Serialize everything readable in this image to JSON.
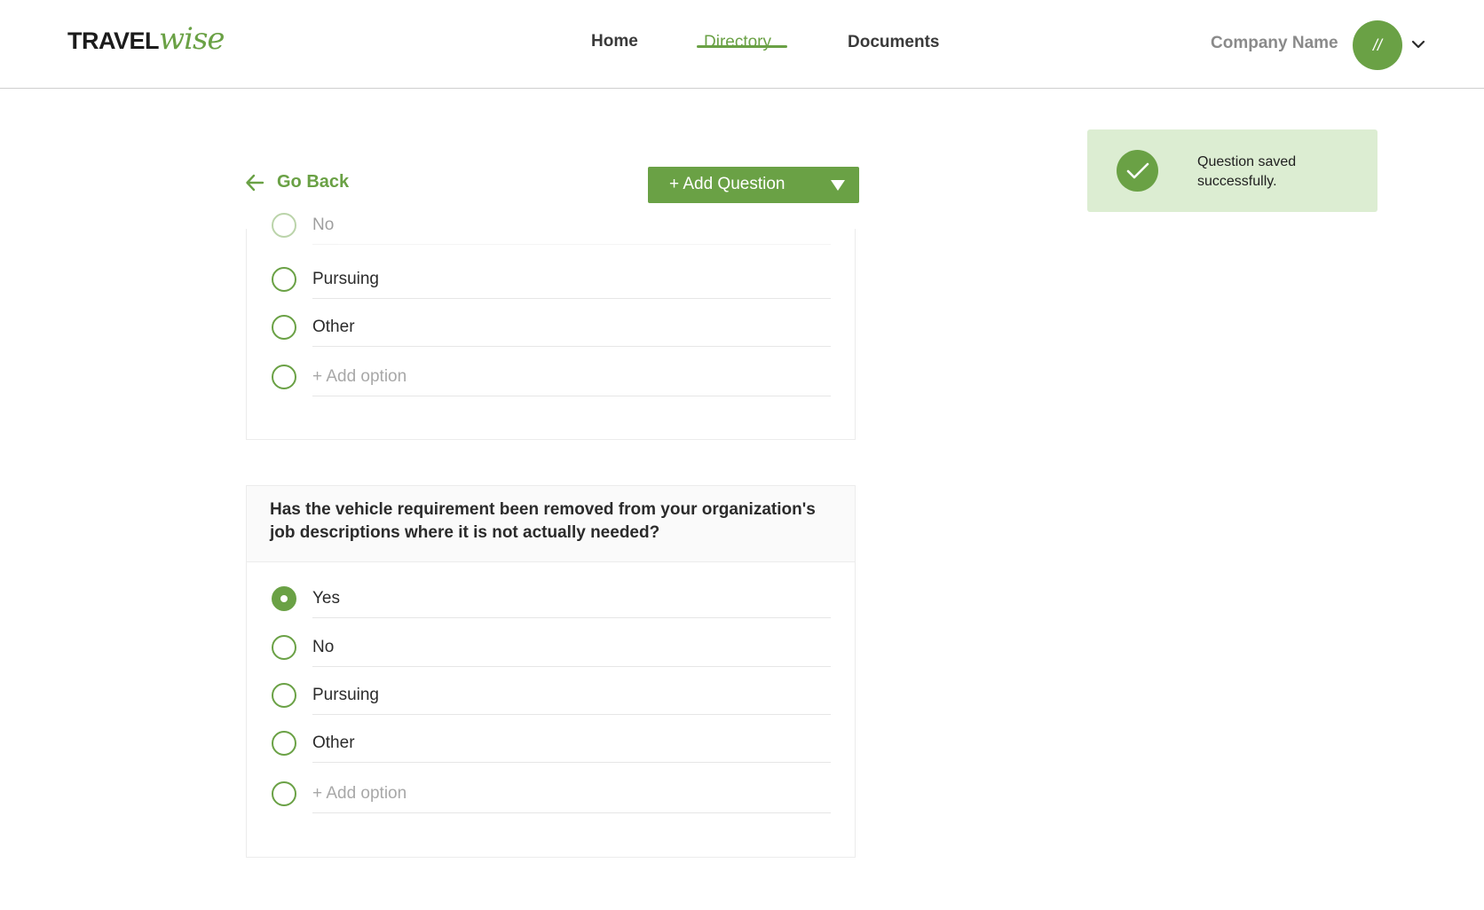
{
  "header": {
    "logo_part1": "TRAVEL",
    "logo_part2": "wise",
    "nav": [
      {
        "label": "Home"
      },
      {
        "label": "Directory"
      },
      {
        "label": "Documents"
      }
    ],
    "company_name": "Company Name",
    "avatar_initials": "//"
  },
  "toast": {
    "message": "Question saved successfully."
  },
  "toolbar": {
    "go_back": "Go Back",
    "add_question": "+ Add Question"
  },
  "card1": {
    "options": [
      {
        "label": "No"
      },
      {
        "label": "Pursuing"
      },
      {
        "label": "Other"
      }
    ],
    "add_option": "+ Add option"
  },
  "card2": {
    "question": "Has the vehicle requirement been removed from your organization's job descriptions where it is not actually needed?",
    "selected": "Yes",
    "options": [
      {
        "label": "Yes"
      },
      {
        "label": "No"
      },
      {
        "label": "Pursuing"
      },
      {
        "label": "Other"
      }
    ],
    "add_option": "+ Add option"
  },
  "colors": {
    "accent": "#6aa145",
    "toast_bg": "#dcedd2"
  }
}
